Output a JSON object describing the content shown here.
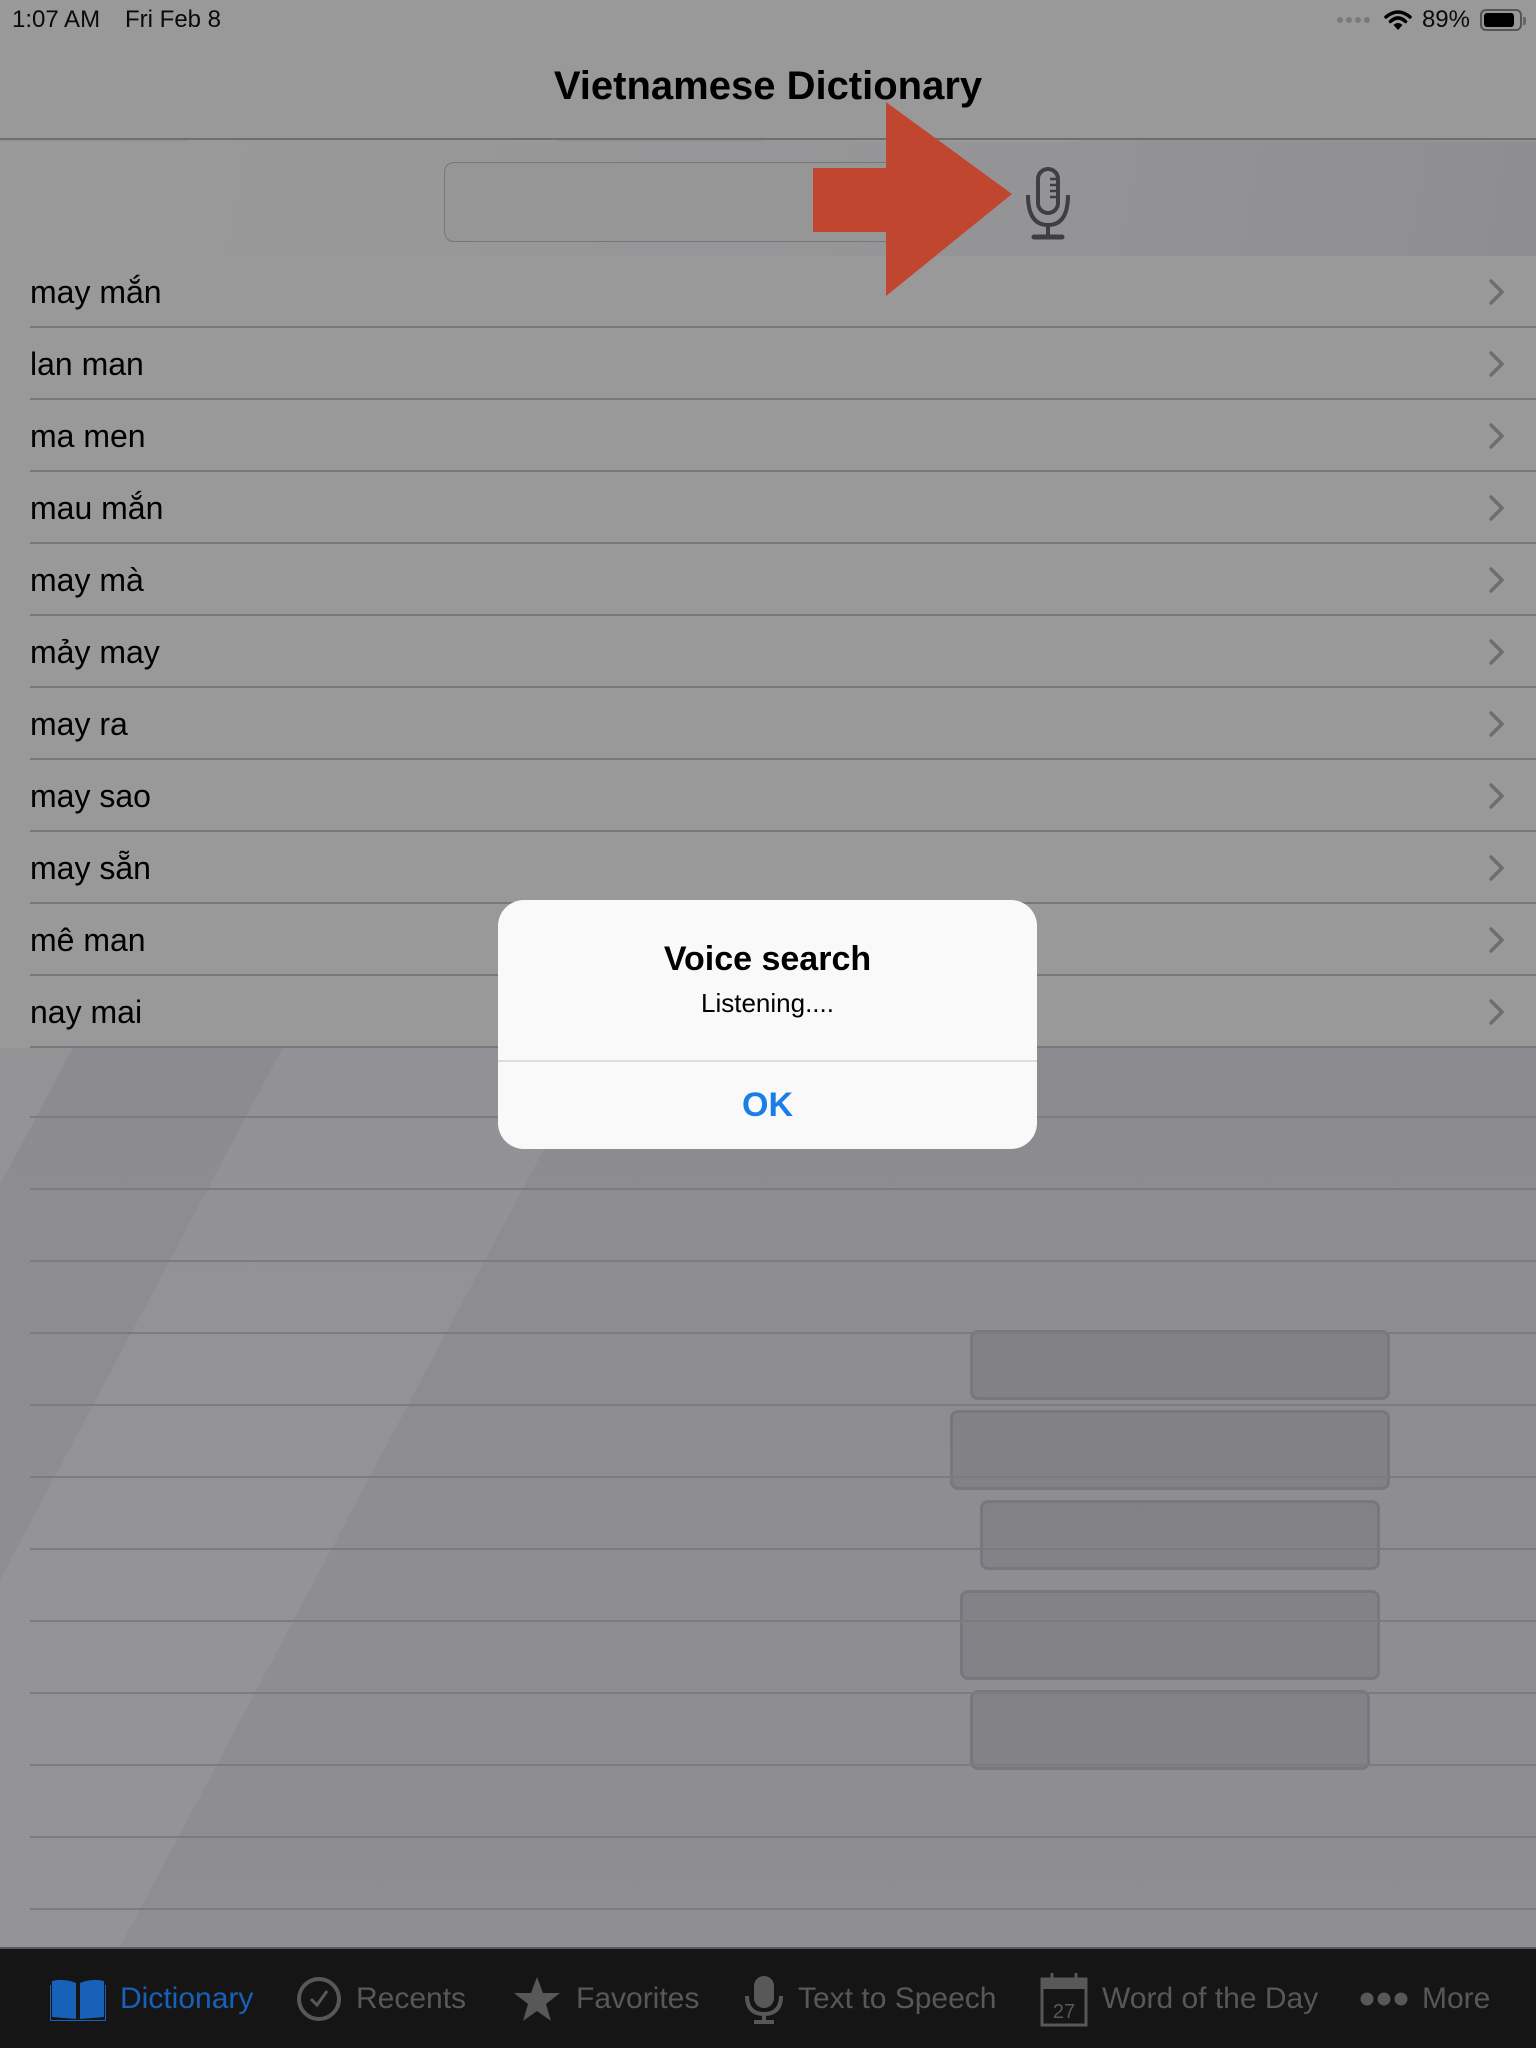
{
  "status_bar": {
    "time": "1:07 AM",
    "date": "Fri Feb 8",
    "battery_percent_label": "89%",
    "battery_level": 0.89,
    "wifi_icon": "wifi-icon",
    "signal_icon": "cellular-dots-icon"
  },
  "nav": {
    "title": "Vietnamese Dictionary"
  },
  "search": {
    "value": "",
    "placeholder": "",
    "mic_icon": "microphone-icon"
  },
  "annotation": {
    "arrow_color": "#c0462f",
    "points_to": "microphone-icon"
  },
  "word_list": {
    "items": [
      {
        "word": "may mắn"
      },
      {
        "word": "lan man"
      },
      {
        "word": "ma men"
      },
      {
        "word": "mau mắn"
      },
      {
        "word": "may mà"
      },
      {
        "word": "mảy may"
      },
      {
        "word": "may ra"
      },
      {
        "word": "may sao"
      },
      {
        "word": "may sẵn"
      },
      {
        "word": "mê man"
      },
      {
        "word": "nay mai"
      }
    ]
  },
  "alert": {
    "title": "Voice search",
    "message": "Listening....",
    "ok_label": "OK",
    "ok_color": "#1a7ee8"
  },
  "tab_bar": {
    "active_color": "#1861b8",
    "inactive_color": "#585858",
    "tabs": [
      {
        "label": "Dictionary",
        "icon": "open-book-icon",
        "active": true
      },
      {
        "label": "Recents",
        "icon": "checkmark-circle-icon",
        "active": false
      },
      {
        "label": "Favorites",
        "icon": "star-icon",
        "active": false
      },
      {
        "label": "Text to Speech",
        "icon": "microphone-icon",
        "active": false
      },
      {
        "label": "Word of the Day",
        "icon": "calendar-icon",
        "active": false,
        "icon_text": "27"
      },
      {
        "label": "More",
        "icon": "more-dots-icon",
        "active": false
      }
    ]
  }
}
